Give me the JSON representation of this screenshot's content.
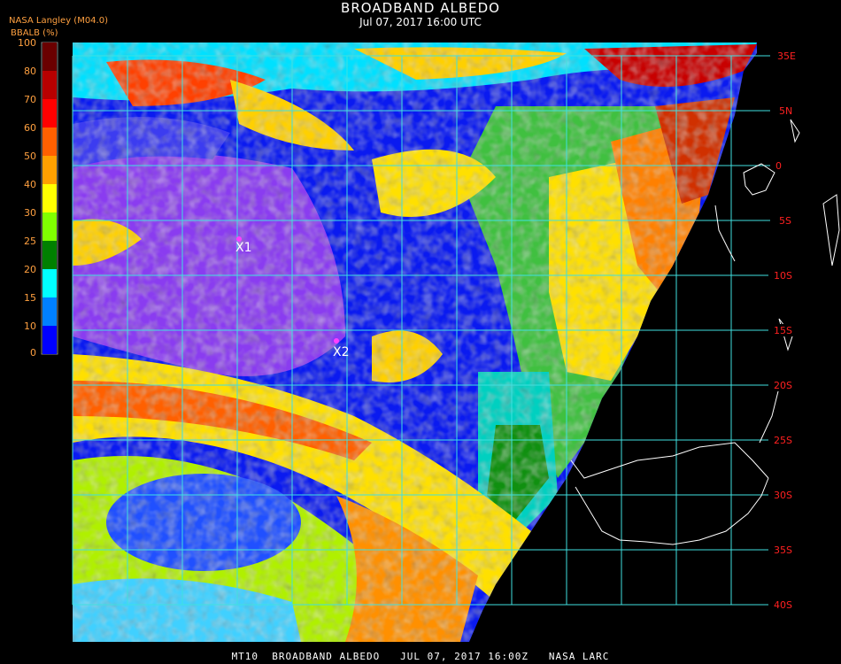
{
  "header": {
    "title": "BROADBAND ALBEDO",
    "subtitle": "Jul 07, 2017 16:00 UTC",
    "source": "NASA Langley (M04.0)",
    "units": "BBALB (%)"
  },
  "footer": {
    "caption": "MT10  BROADBAND ALBEDO   JUL 07, 2017 16:00Z   NASA LARC"
  },
  "legend": {
    "ticks": [
      "100",
      "80",
      "70",
      "60",
      "50",
      "40",
      "30",
      "25",
      "20",
      "15",
      "10",
      "0"
    ],
    "colors": [
      "#6a0000",
      "#b80000",
      "#ff0000",
      "#ff6000",
      "#ffa000",
      "#ffff00",
      "#80ff00",
      "#008000",
      "#00ffff",
      "#0080ff",
      "#0000ff",
      "#8040ff"
    ]
  },
  "map": {
    "lat_labels": [
      "35E",
      "5N",
      "0",
      "5S",
      "10S",
      "15S",
      "20S",
      "25S",
      "30S",
      "35S",
      "40S"
    ],
    "markers": [
      {
        "label": "X1",
        "color": "#ff40ff"
      },
      {
        "label": "X2",
        "color": "#ff40ff"
      }
    ],
    "grid_color": "#40e0e0",
    "label_color": "#ff2020"
  }
}
